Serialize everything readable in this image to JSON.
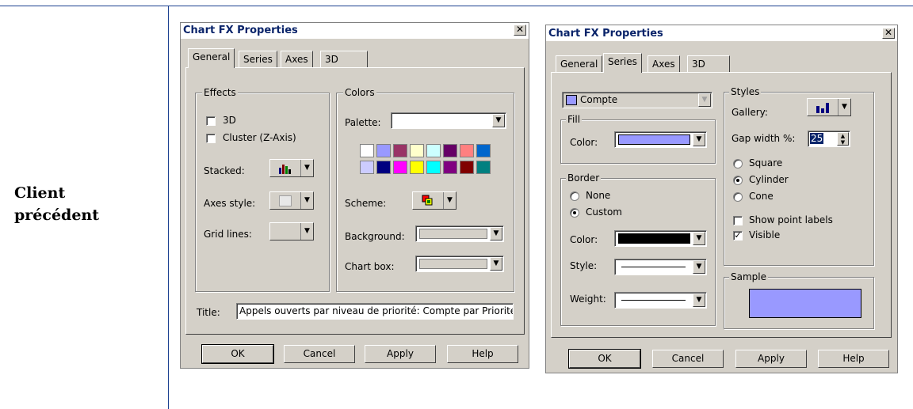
{
  "side_label": [
    "Client",
    "précédent"
  ],
  "left_dialog": {
    "title": "Chart FX Properties",
    "tabs": [
      "General",
      "Series",
      "Axes",
      "3D"
    ],
    "effects": {
      "legend": "Effects",
      "cb_3d": "3D",
      "cb_cluster": "Cluster (Z-Axis)",
      "stacked": "Stacked:",
      "axes_style": "Axes style:",
      "grid_lines": "Grid lines:"
    },
    "colors": {
      "legend": "Colors",
      "palette": "Palette:",
      "palette_value": "",
      "swatches_row1": [
        "#ffffff",
        "#9999ff",
        "#993366",
        "#ffffcc",
        "#ccffff",
        "#660066",
        "#ff8080",
        "#0066cc"
      ],
      "swatches_row2": [
        "#ccccff",
        "#000080",
        "#ff00ff",
        "#ffff00",
        "#00ffff",
        "#800080",
        "#800000",
        "#008080"
      ],
      "scheme": "Scheme:",
      "background": "Background:",
      "chart_box": "Chart box:"
    },
    "title_label": "Title:",
    "title_value": "Appels ouverts par niveau de priorité: Compte par Priorité",
    "buttons": {
      "ok": "OK",
      "cancel": "Cancel",
      "apply": "Apply",
      "help": "Help"
    }
  },
  "right_dialog": {
    "title": "Chart FX Properties",
    "tabs": [
      "General",
      "Series",
      "Axes",
      "3D"
    ],
    "series_select": "Compte",
    "series_color": "#9999ff",
    "fill": {
      "legend": "Fill",
      "color": "Color:",
      "color_value": "#9999ff"
    },
    "border": {
      "legend": "Border",
      "none": "None",
      "custom": "Custom",
      "color": "Color:",
      "color_value": "#000000",
      "style": "Style:",
      "weight": "Weight:"
    },
    "styles": {
      "legend": "Styles",
      "gallery": "Gallery:",
      "gap_width": "Gap width %:",
      "gap_value": "25",
      "square": "Square",
      "cylinder": "Cylinder",
      "cone": "Cone",
      "show_point_labels": "Show point labels",
      "visible": "Visible"
    },
    "sample": {
      "legend": "Sample",
      "color": "#9999ff"
    },
    "buttons": {
      "ok": "OK",
      "cancel": "Cancel",
      "apply": "Apply",
      "help": "Help"
    }
  }
}
